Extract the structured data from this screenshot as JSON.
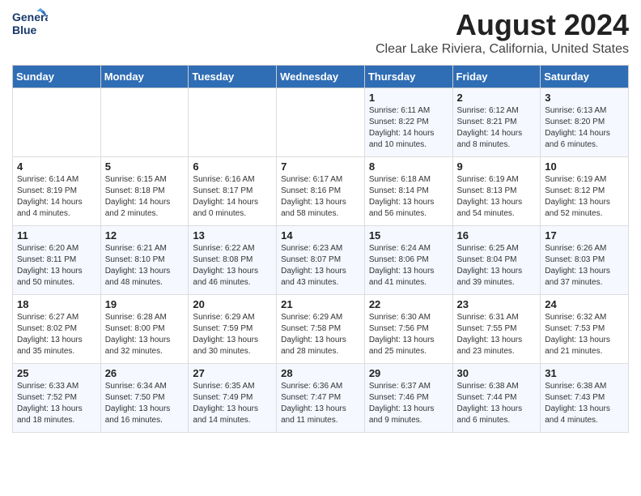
{
  "header": {
    "logo_line1": "General",
    "logo_line2": "Blue",
    "month_year": "August 2024",
    "location": "Clear Lake Riviera, California, United States"
  },
  "weekdays": [
    "Sunday",
    "Monday",
    "Tuesday",
    "Wednesday",
    "Thursday",
    "Friday",
    "Saturday"
  ],
  "weeks": [
    [
      {
        "day": "",
        "info": ""
      },
      {
        "day": "",
        "info": ""
      },
      {
        "day": "",
        "info": ""
      },
      {
        "day": "",
        "info": ""
      },
      {
        "day": "1",
        "info": "Sunrise: 6:11 AM\nSunset: 8:22 PM\nDaylight: 14 hours\nand 10 minutes."
      },
      {
        "day": "2",
        "info": "Sunrise: 6:12 AM\nSunset: 8:21 PM\nDaylight: 14 hours\nand 8 minutes."
      },
      {
        "day": "3",
        "info": "Sunrise: 6:13 AM\nSunset: 8:20 PM\nDaylight: 14 hours\nand 6 minutes."
      }
    ],
    [
      {
        "day": "4",
        "info": "Sunrise: 6:14 AM\nSunset: 8:19 PM\nDaylight: 14 hours\nand 4 minutes."
      },
      {
        "day": "5",
        "info": "Sunrise: 6:15 AM\nSunset: 8:18 PM\nDaylight: 14 hours\nand 2 minutes."
      },
      {
        "day": "6",
        "info": "Sunrise: 6:16 AM\nSunset: 8:17 PM\nDaylight: 14 hours\nand 0 minutes."
      },
      {
        "day": "7",
        "info": "Sunrise: 6:17 AM\nSunset: 8:16 PM\nDaylight: 13 hours\nand 58 minutes."
      },
      {
        "day": "8",
        "info": "Sunrise: 6:18 AM\nSunset: 8:14 PM\nDaylight: 13 hours\nand 56 minutes."
      },
      {
        "day": "9",
        "info": "Sunrise: 6:19 AM\nSunset: 8:13 PM\nDaylight: 13 hours\nand 54 minutes."
      },
      {
        "day": "10",
        "info": "Sunrise: 6:19 AM\nSunset: 8:12 PM\nDaylight: 13 hours\nand 52 minutes."
      }
    ],
    [
      {
        "day": "11",
        "info": "Sunrise: 6:20 AM\nSunset: 8:11 PM\nDaylight: 13 hours\nand 50 minutes."
      },
      {
        "day": "12",
        "info": "Sunrise: 6:21 AM\nSunset: 8:10 PM\nDaylight: 13 hours\nand 48 minutes."
      },
      {
        "day": "13",
        "info": "Sunrise: 6:22 AM\nSunset: 8:08 PM\nDaylight: 13 hours\nand 46 minutes."
      },
      {
        "day": "14",
        "info": "Sunrise: 6:23 AM\nSunset: 8:07 PM\nDaylight: 13 hours\nand 43 minutes."
      },
      {
        "day": "15",
        "info": "Sunrise: 6:24 AM\nSunset: 8:06 PM\nDaylight: 13 hours\nand 41 minutes."
      },
      {
        "day": "16",
        "info": "Sunrise: 6:25 AM\nSunset: 8:04 PM\nDaylight: 13 hours\nand 39 minutes."
      },
      {
        "day": "17",
        "info": "Sunrise: 6:26 AM\nSunset: 8:03 PM\nDaylight: 13 hours\nand 37 minutes."
      }
    ],
    [
      {
        "day": "18",
        "info": "Sunrise: 6:27 AM\nSunset: 8:02 PM\nDaylight: 13 hours\nand 35 minutes."
      },
      {
        "day": "19",
        "info": "Sunrise: 6:28 AM\nSunset: 8:00 PM\nDaylight: 13 hours\nand 32 minutes."
      },
      {
        "day": "20",
        "info": "Sunrise: 6:29 AM\nSunset: 7:59 PM\nDaylight: 13 hours\nand 30 minutes."
      },
      {
        "day": "21",
        "info": "Sunrise: 6:29 AM\nSunset: 7:58 PM\nDaylight: 13 hours\nand 28 minutes."
      },
      {
        "day": "22",
        "info": "Sunrise: 6:30 AM\nSunset: 7:56 PM\nDaylight: 13 hours\nand 25 minutes."
      },
      {
        "day": "23",
        "info": "Sunrise: 6:31 AM\nSunset: 7:55 PM\nDaylight: 13 hours\nand 23 minutes."
      },
      {
        "day": "24",
        "info": "Sunrise: 6:32 AM\nSunset: 7:53 PM\nDaylight: 13 hours\nand 21 minutes."
      }
    ],
    [
      {
        "day": "25",
        "info": "Sunrise: 6:33 AM\nSunset: 7:52 PM\nDaylight: 13 hours\nand 18 minutes."
      },
      {
        "day": "26",
        "info": "Sunrise: 6:34 AM\nSunset: 7:50 PM\nDaylight: 13 hours\nand 16 minutes."
      },
      {
        "day": "27",
        "info": "Sunrise: 6:35 AM\nSunset: 7:49 PM\nDaylight: 13 hours\nand 14 minutes."
      },
      {
        "day": "28",
        "info": "Sunrise: 6:36 AM\nSunset: 7:47 PM\nDaylight: 13 hours\nand 11 minutes."
      },
      {
        "day": "29",
        "info": "Sunrise: 6:37 AM\nSunset: 7:46 PM\nDaylight: 13 hours\nand 9 minutes."
      },
      {
        "day": "30",
        "info": "Sunrise: 6:38 AM\nSunset: 7:44 PM\nDaylight: 13 hours\nand 6 minutes."
      },
      {
        "day": "31",
        "info": "Sunrise: 6:38 AM\nSunset: 7:43 PM\nDaylight: 13 hours\nand 4 minutes."
      }
    ]
  ]
}
